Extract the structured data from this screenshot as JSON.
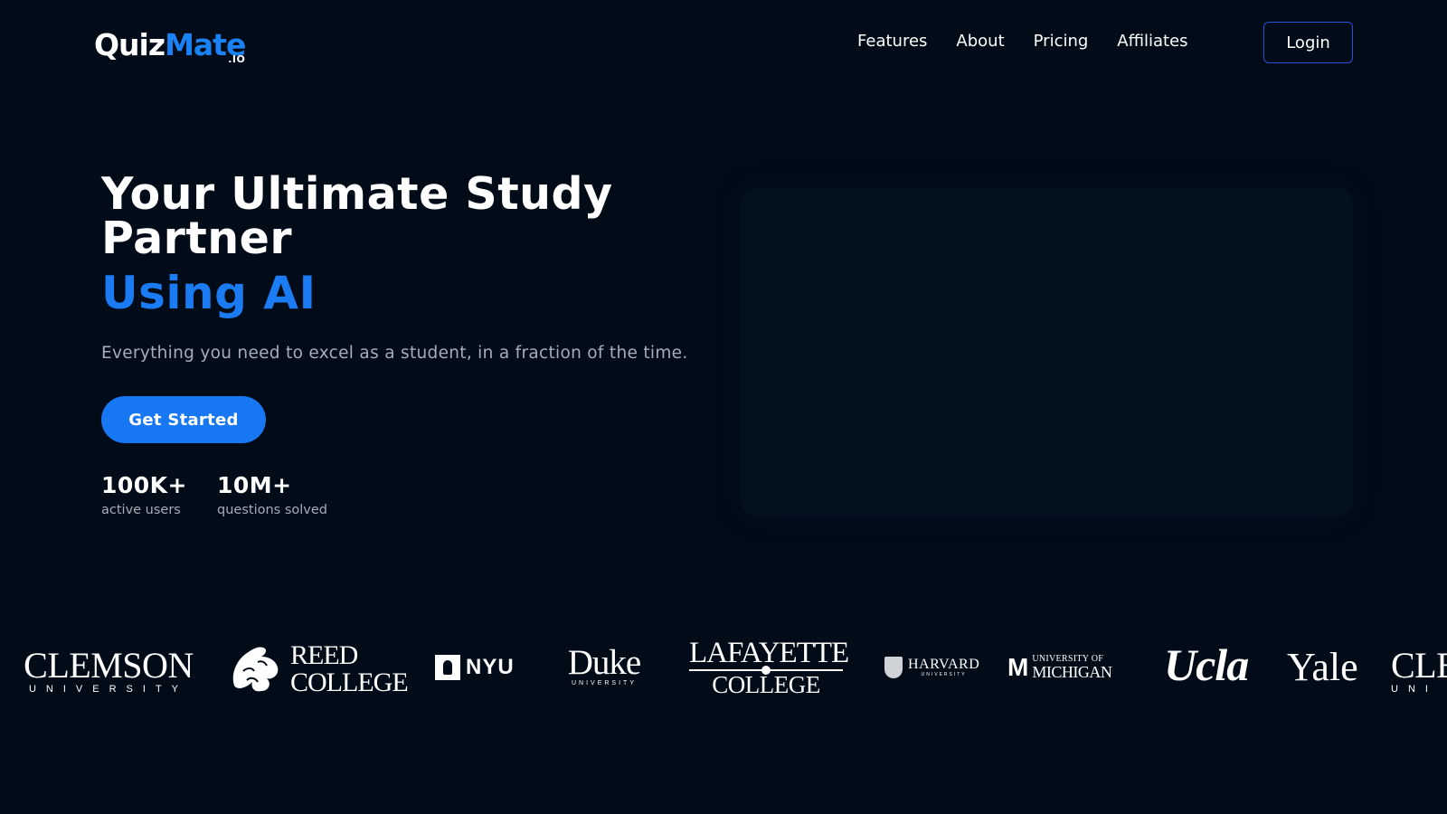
{
  "brand": {
    "logo_primary": "Quiz",
    "logo_accent": "Mate",
    "logo_suffix": ".IO",
    "accent_color": "#1a7bf2",
    "background_color": "#020b18"
  },
  "nav": {
    "items": [
      {
        "label": "Features"
      },
      {
        "label": "About"
      },
      {
        "label": "Pricing"
      },
      {
        "label": "Affiliates"
      }
    ],
    "login_label": "Login"
  },
  "hero": {
    "title": "Your Ultimate Study Partner",
    "title_accent": "Using AI",
    "subtitle": "Everything you need to excel as a student, in a fraction of the time.",
    "cta_label": "Get Started",
    "stats": [
      {
        "value": "100K+",
        "label": "active users"
      },
      {
        "value": "10M+",
        "label": "questions solved"
      }
    ]
  },
  "universities": [
    {
      "name": "CLEMSON",
      "sub": "UNIVERSITY"
    },
    {
      "name": "REED",
      "sub": "COLLEGE"
    },
    {
      "name": "NYU"
    },
    {
      "name": "Duke",
      "sub": "UNIVERSITY"
    },
    {
      "name": "LAFAYETTE",
      "sub": "COLLEGE"
    },
    {
      "name": "HARVARD",
      "sub": "UNIVERSITY"
    },
    {
      "name": "MICHIGAN",
      "sub": "UNIVERSITY OF"
    },
    {
      "name": "Ucla"
    },
    {
      "name": "Yale"
    },
    {
      "name": "CLE",
      "sub": "UNI"
    }
  ]
}
